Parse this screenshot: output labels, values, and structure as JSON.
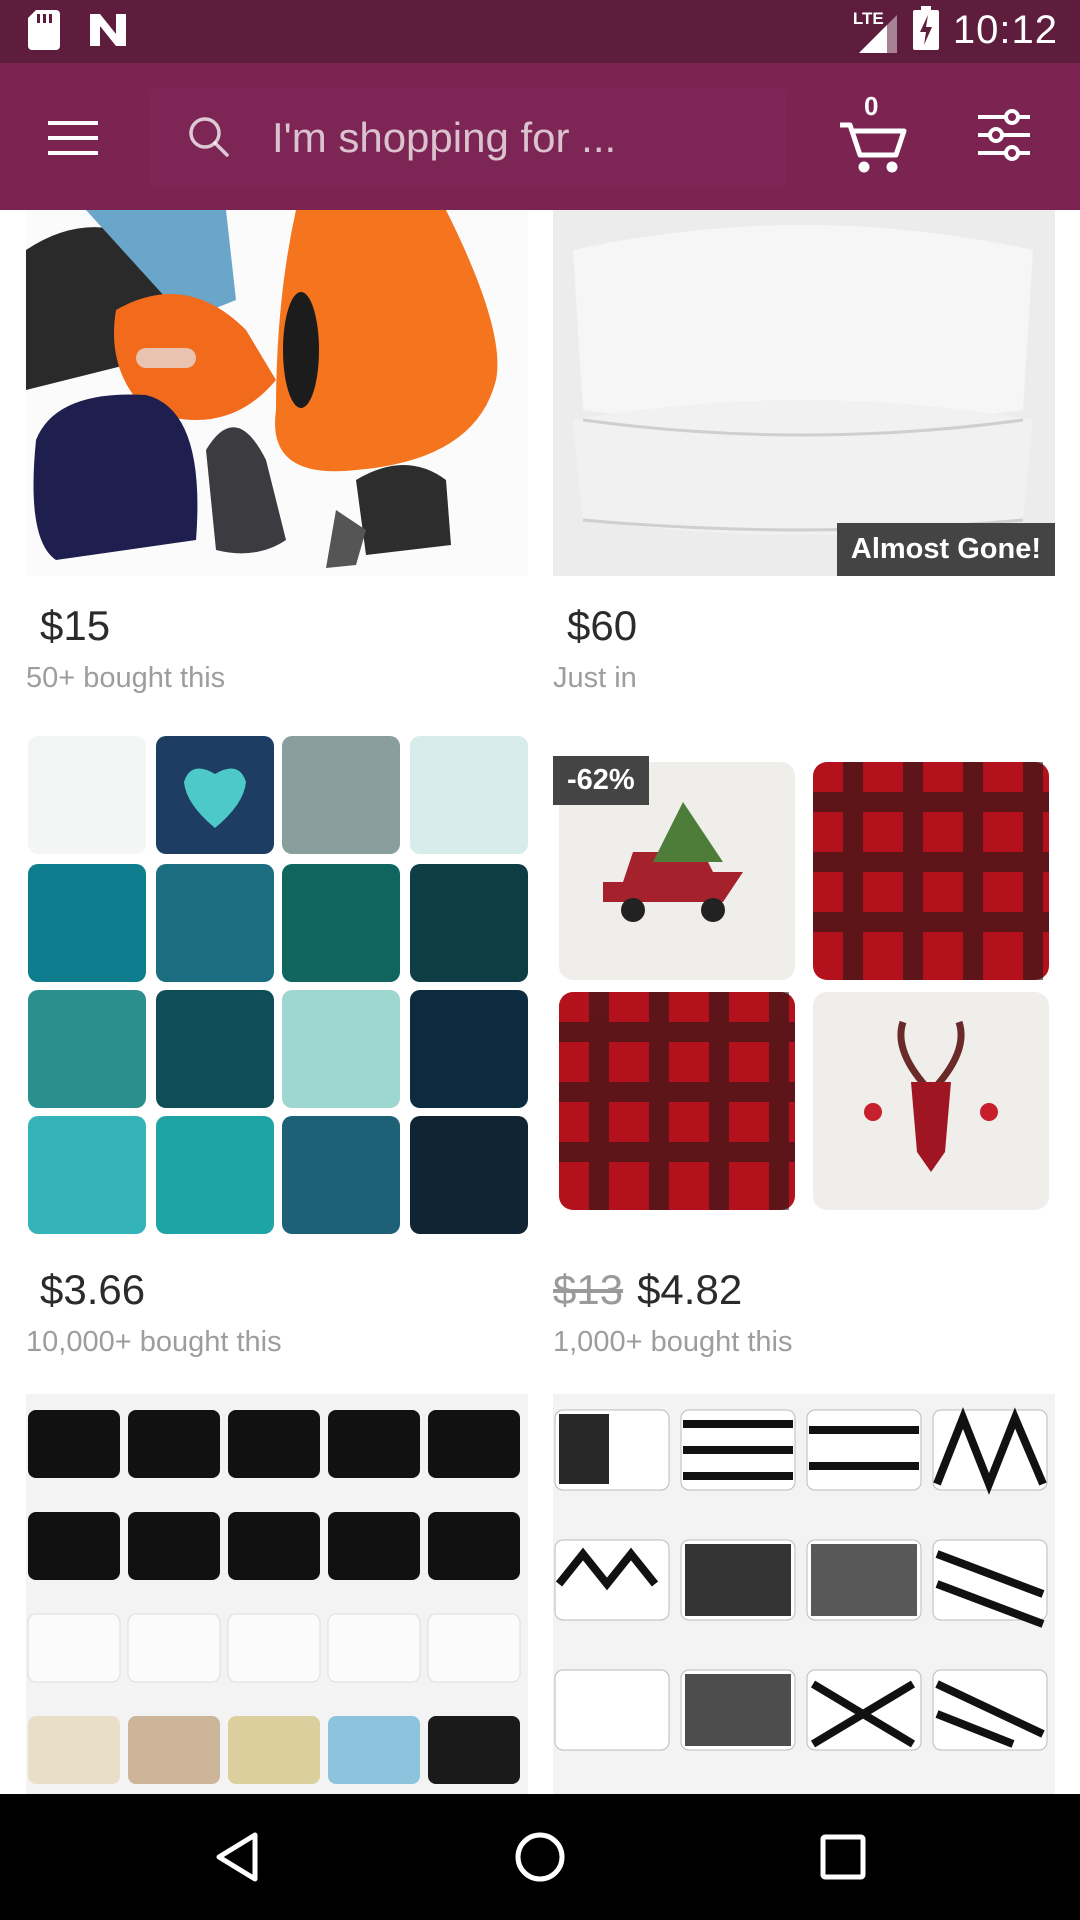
{
  "status_bar": {
    "time": "10:12",
    "network": "LTE"
  },
  "toolbar": {
    "menu_icon": "hamburger-menu-icon",
    "search_placeholder": "I'm shopping for ...",
    "cart_count": "0",
    "filter_icon": "filter-sliders-icon"
  },
  "products": [
    {
      "price": "$15",
      "old_price": "",
      "subtitle": "50+ bought this",
      "badge": ""
    },
    {
      "price": "$60",
      "old_price": "",
      "subtitle": "Just in",
      "badge": "Almost Gone!"
    },
    {
      "price": "$3.66",
      "old_price": "",
      "subtitle": "10,000+ bought this",
      "badge": ""
    },
    {
      "price": "$4.82",
      "old_price": "$13",
      "subtitle": "1,000+ bought this",
      "badge": "-62%"
    },
    {
      "price": "",
      "old_price": "",
      "subtitle": "",
      "badge": ""
    },
    {
      "price": "",
      "old_price": "",
      "subtitle": "",
      "badge": ""
    }
  ],
  "colors": {
    "status_bar": "#5e1d3c",
    "toolbar": "#7b2351"
  },
  "nav_bar": {
    "back_icon": "back-triangle-icon",
    "home_icon": "home-circle-icon",
    "recents_icon": "recents-square-icon"
  }
}
